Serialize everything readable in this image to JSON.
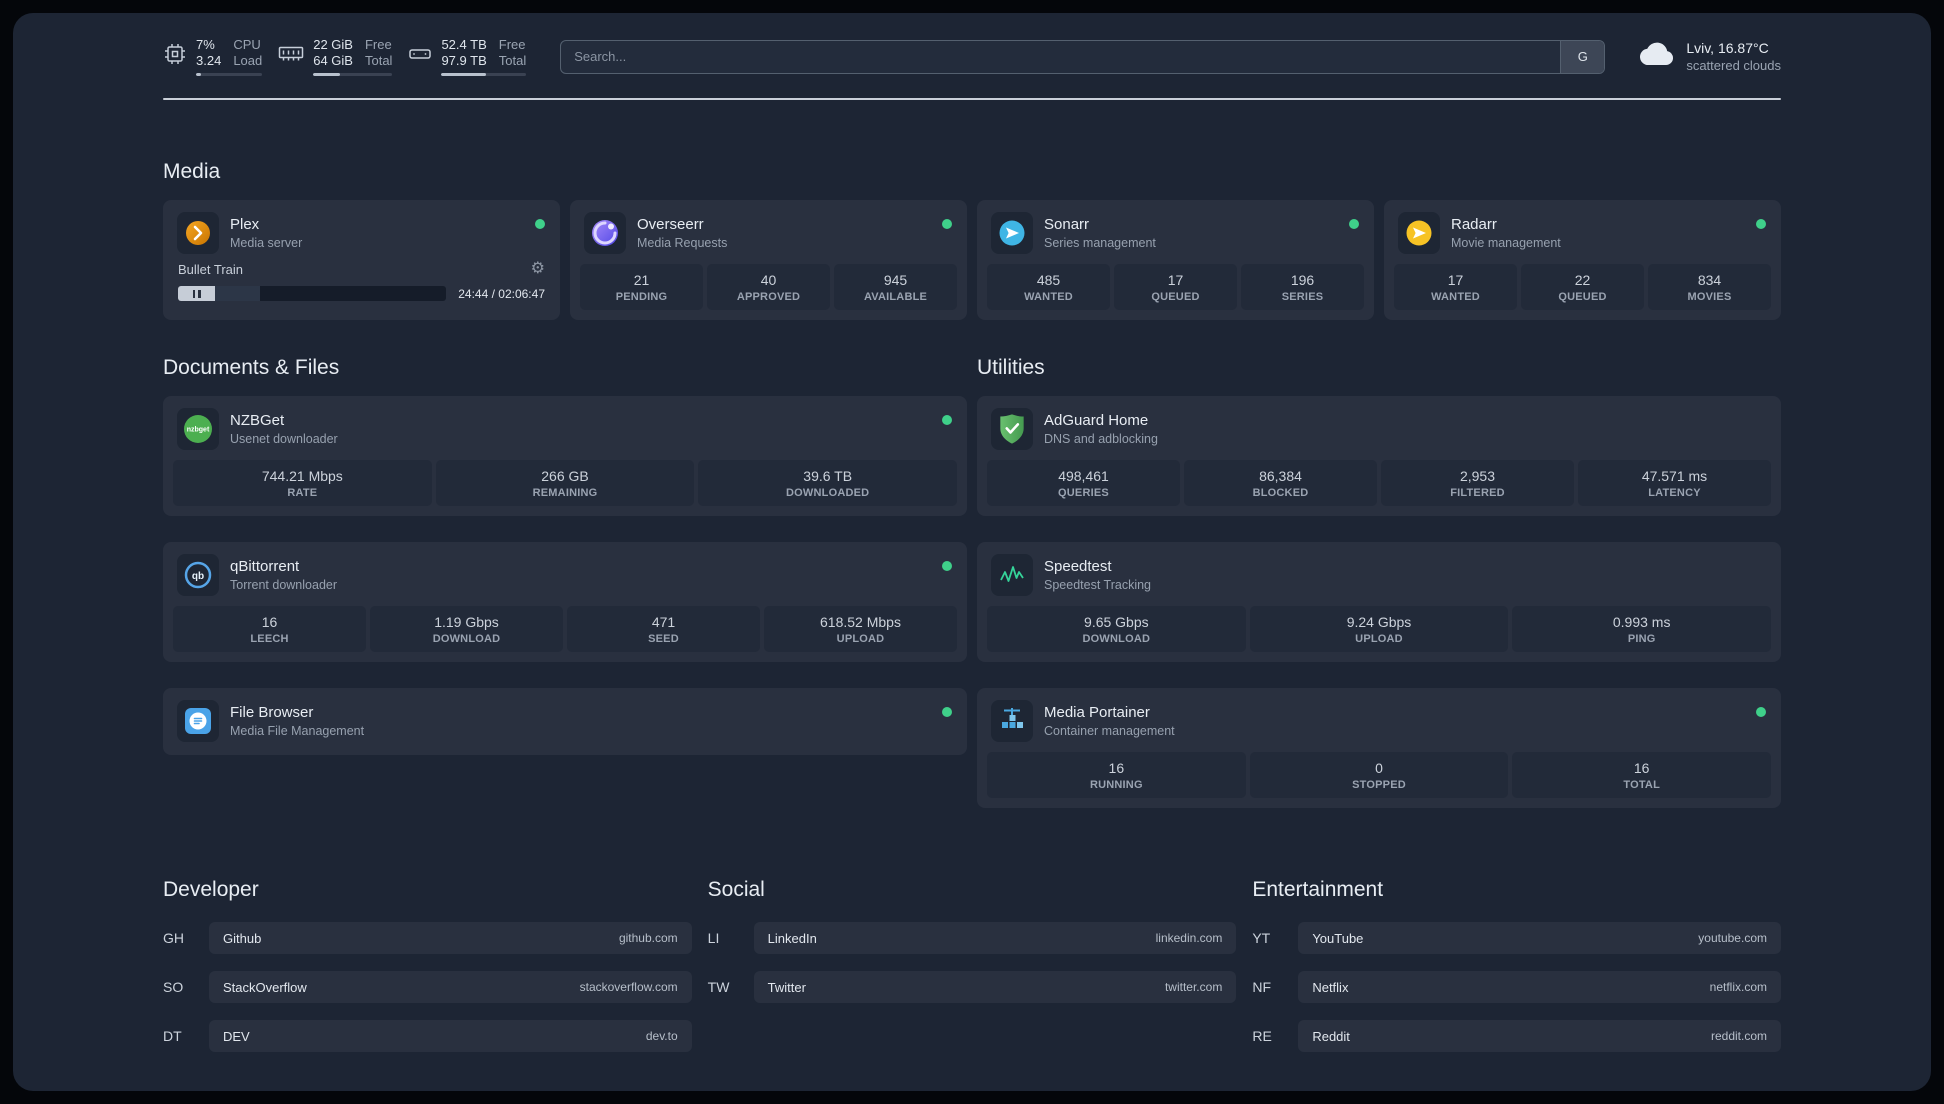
{
  "colors": {
    "background": "#1d2534",
    "card": "#29303f",
    "stat_block": "#222a39",
    "status_online": "#3fd08a",
    "accent_text": "#e8edf3"
  },
  "topbar": {
    "resources": [
      {
        "icon": "cpu-icon",
        "values": [
          "7%",
          "3.24"
        ],
        "labels": [
          "CPU",
          "Load"
        ],
        "progress_pct": 7
      },
      {
        "icon": "memory-icon",
        "values": [
          "22 GiB",
          "64 GiB"
        ],
        "labels": [
          "Free",
          "Total"
        ],
        "progress_pct": 34
      },
      {
        "icon": "disk-icon",
        "values": [
          "52.4 TB",
          "97.9 TB"
        ],
        "labels": [
          "Free",
          "Total"
        ],
        "progress_pct": 53
      }
    ],
    "search": {
      "placeholder": "Search...",
      "provider": "G"
    },
    "weather": {
      "icon": "cloud-icon",
      "location": "Lviv, 16.87°C",
      "condition": "scattered clouds"
    }
  },
  "groups": {
    "media": {
      "title": "Media",
      "services": {
        "plex": {
          "name": "Plex",
          "desc": "Media server",
          "icon": "plex-icon",
          "status": "online",
          "player": {
            "track": "Bullet Train",
            "time": "24:44 / 02:06:47",
            "progress_pct": 19.5
          }
        },
        "overseerr": {
          "name": "Overseerr",
          "desc": "Media Requests",
          "icon": "overseerr-icon",
          "status": "online",
          "stats": [
            {
              "value": "21",
              "label": "PENDING"
            },
            {
              "value": "40",
              "label": "APPROVED"
            },
            {
              "value": "945",
              "label": "AVAILABLE"
            }
          ]
        },
        "sonarr": {
          "name": "Sonarr",
          "desc": "Series management",
          "icon": "sonarr-icon",
          "status": "online",
          "stats": [
            {
              "value": "485",
              "label": "WANTED"
            },
            {
              "value": "17",
              "label": "QUEUED"
            },
            {
              "value": "196",
              "label": "SERIES"
            }
          ]
        },
        "radarr": {
          "name": "Radarr",
          "desc": "Movie management",
          "icon": "radarr-icon",
          "status": "online",
          "stats": [
            {
              "value": "17",
              "label": "WANTED"
            },
            {
              "value": "22",
              "label": "QUEUED"
            },
            {
              "value": "834",
              "label": "MOVIES"
            }
          ]
        }
      }
    },
    "documents": {
      "title": "Documents & Files",
      "services": {
        "nzbget": {
          "name": "NZBGet",
          "desc": "Usenet downloader",
          "icon": "nzbget-icon",
          "status": "online",
          "stats": [
            {
              "value": "744.21 Mbps",
              "label": "RATE"
            },
            {
              "value": "266 GB",
              "label": "REMAINING"
            },
            {
              "value": "39.6 TB",
              "label": "DOWNLOADED"
            }
          ]
        },
        "qbittorrent": {
          "name": "qBittorrent",
          "desc": "Torrent downloader",
          "icon": "qbittorrent-icon",
          "status": "online",
          "stats": [
            {
              "value": "16",
              "label": "LEECH"
            },
            {
              "value": "1.19 Gbps",
              "label": "DOWNLOAD"
            },
            {
              "value": "471",
              "label": "SEED"
            },
            {
              "value": "618.52 Mbps",
              "label": "UPLOAD"
            }
          ]
        },
        "filebrowser": {
          "name": "File Browser",
          "desc": "Media File Management",
          "icon": "filebrowser-icon",
          "status": "online"
        }
      }
    },
    "utilities": {
      "title": "Utilities",
      "services": {
        "adguard": {
          "name": "AdGuard Home",
          "desc": "DNS and adblocking",
          "icon": "adguard-icon",
          "stats": [
            {
              "value": "498,461",
              "label": "QUERIES"
            },
            {
              "value": "86,384",
              "label": "BLOCKED"
            },
            {
              "value": "2,953",
              "label": "FILTERED"
            },
            {
              "value": "47.571 ms",
              "label": "LATENCY"
            }
          ]
        },
        "speedtest": {
          "name": "Speedtest",
          "desc": "Speedtest Tracking",
          "icon": "speedtest-icon",
          "stats": [
            {
              "value": "9.65 Gbps",
              "label": "DOWNLOAD"
            },
            {
              "value": "9.24 Gbps",
              "label": "UPLOAD"
            },
            {
              "value": "0.993 ms",
              "label": "PING"
            }
          ]
        },
        "portainer": {
          "name": "Media Portainer",
          "desc": "Container management",
          "icon": "portainer-icon",
          "status": "online",
          "stats": [
            {
              "value": "16",
              "label": "RUNNING"
            },
            {
              "value": "0",
              "label": "STOPPED"
            },
            {
              "value": "16",
              "label": "TOTAL"
            }
          ]
        }
      }
    }
  },
  "bookmarks": {
    "developer": {
      "title": "Developer",
      "items": [
        {
          "abbr": "GH",
          "name": "Github",
          "url": "github.com"
        },
        {
          "abbr": "SO",
          "name": "StackOverflow",
          "url": "stackoverflow.com"
        },
        {
          "abbr": "DT",
          "name": "DEV",
          "url": "dev.to"
        }
      ]
    },
    "social": {
      "title": "Social",
      "items": [
        {
          "abbr": "LI",
          "name": "LinkedIn",
          "url": "linkedin.com"
        },
        {
          "abbr": "TW",
          "name": "Twitter",
          "url": "twitter.com"
        }
      ]
    },
    "entertainment": {
      "title": "Entertainment",
      "items": [
        {
          "abbr": "YT",
          "name": "YouTube",
          "url": "youtube.com"
        },
        {
          "abbr": "NF",
          "name": "Netflix",
          "url": "netflix.com"
        },
        {
          "abbr": "RE",
          "name": "Reddit",
          "url": "reddit.com"
        }
      ]
    }
  }
}
